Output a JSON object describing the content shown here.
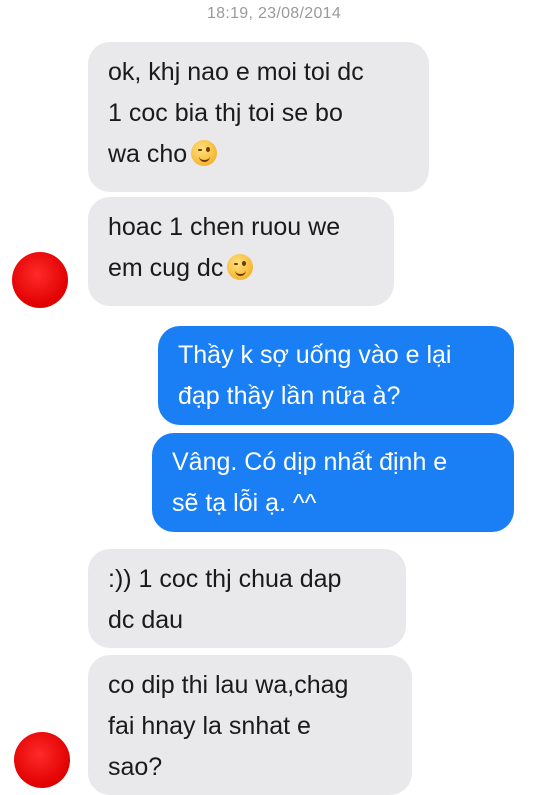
{
  "timestamp": "18:19, 23/08/2014",
  "messages": [
    {
      "sender": "other",
      "lines": [
        "ok, khj nao e moi toi dc",
        "1 coc bia thj toi se bo",
        "wa cho"
      ],
      "emoji": "winking-face-icon"
    },
    {
      "sender": "other",
      "lines": [
        "hoac 1 chen ruou we",
        "em cug dc"
      ],
      "emoji": "winking-face-icon"
    },
    {
      "sender": "me",
      "lines": [
        "Thầy k sợ uống vào e lại",
        "đạp thầy lần nữa à?"
      ]
    },
    {
      "sender": "me",
      "lines": [
        "Vâng. Có dịp nhất định e",
        "sẽ tạ lỗi ạ. ^^"
      ]
    },
    {
      "sender": "other",
      "lines": [
        ":)) 1 coc thj chua dap",
        "dc dau"
      ]
    },
    {
      "sender": "other",
      "lines": [
        "co dip thi lau wa,chag",
        "fai hnay la snhat e",
        "sao?"
      ]
    }
  ],
  "colors": {
    "incoming_bubble": "#e9e9eb",
    "outgoing_bubble": "#1a7ff5",
    "avatar_redaction": "#e00000"
  }
}
